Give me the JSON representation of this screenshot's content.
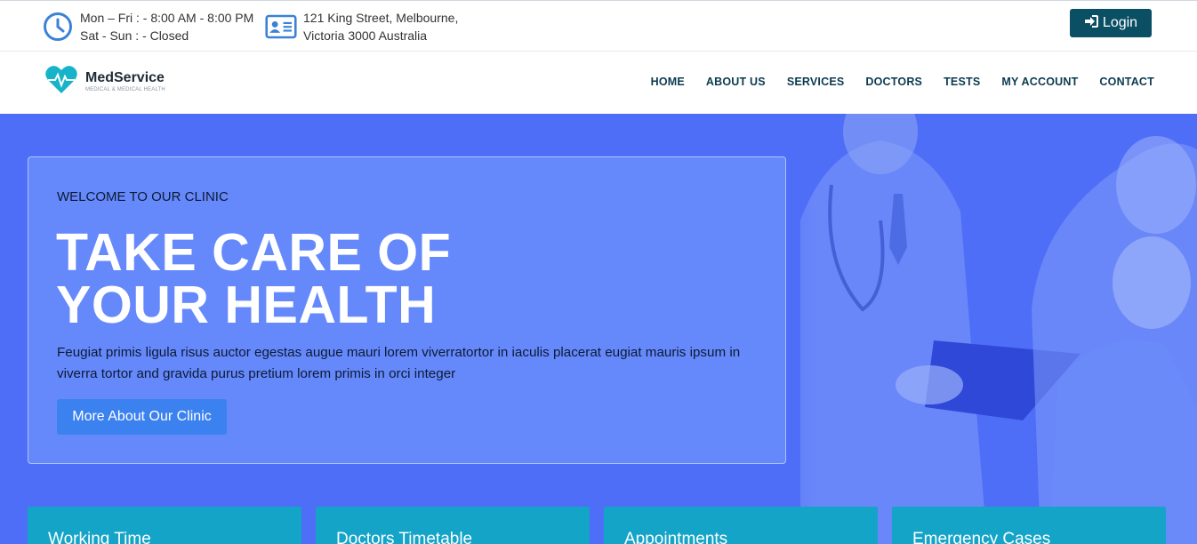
{
  "topbar": {
    "hours_line1": "Mon – Fri : - 8:00 AM - 8:00 PM",
    "hours_line2": "Sat - Sun : - Closed",
    "address_line1": "121 King Street, Melbourne,",
    "address_line2": "Victoria 3000 Australia",
    "login_label": "Login",
    "icons": [
      "clock-icon",
      "id-card-icon",
      "sign-in-icon"
    ]
  },
  "brand": {
    "name": "MedService",
    "tagline": "MEDICAL & MEDICAL HEALTH"
  },
  "nav": {
    "home": "HOME",
    "about": "ABOUT US",
    "services": "SERVICES",
    "doctors": "DOCTORS",
    "tests": "TESTS",
    "account": "MY ACCOUNT",
    "contact": "CONTACT"
  },
  "hero": {
    "eyebrow": "WELCOME TO OUR CLINIC",
    "title_line1": "TAKE CARE OF",
    "title_line2": "YOUR HEALTH",
    "description": "Feugiat primis ligula risus auctor egestas augue mauri lorem viverratortor in iaculis placerat eugiat mauris ipsum in viverra tortor and gravida purus pretium lorem primis in orci integer",
    "cta_label": "More About Our Clinic"
  },
  "features": {
    "working_time": "Working Time",
    "timetable": "Doctors Timetable",
    "appointments": "Appointments",
    "emergency": "Emergency Cases"
  },
  "colors": {
    "hero_bg": "#4f6ef7",
    "login_bg": "#0b4f64",
    "cta_bg": "#3b82f0",
    "feature_bg": "#13a4c8",
    "nav_text": "#0b3a50"
  }
}
